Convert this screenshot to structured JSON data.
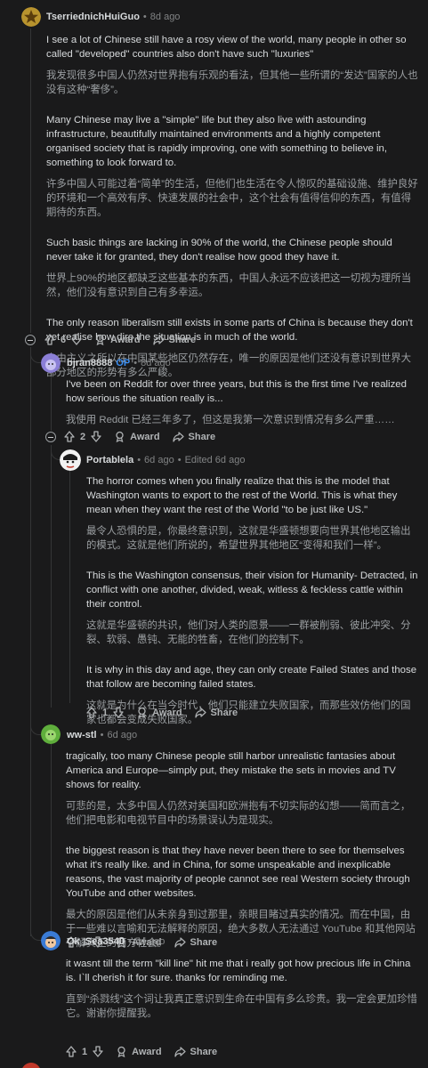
{
  "comments": [
    {
      "author": "TserriednichHuiGuo",
      "time": "8d ago",
      "paragraphs": [
        {
          "en": "I see a lot of Chinese still have a rosy view of the world, many people in other so called \"developed\" countries also don't have such \"luxuries\"",
          "zh": "我发现很多中国人仍然对世界抱有乐观的看法，但其他一些所谓的“发达”国家的人也没有这种“奢侈”。"
        },
        {
          "en": "Many Chinese may live a \"simple\" life but they also live with astounding infrastructure, beautifully maintained environments and a highly competent organised society that is rapidly improving, one with something to believe in, something to look forward to.",
          "zh": "许多中国人可能过着“简单”的生活，但他们也生活在令人惊叹的基础设施、维护良好的环境和一个高效有序、快速发展的社会中，这个社会有值得信仰的东西，有值得期待的东西。"
        },
        {
          "en": "Such basic things are lacking in 90% of the world, the Chinese people should never take it for granted, they don't realise how good they have it.",
          "zh": "世界上90%的地区都缺乏这些基本的东西，中国人永远不应该把这一切视为理所当然，他们没有意识到自己有多幸运。"
        },
        {
          "en": "The only reason liberalism still exists in some parts of China is because they don't yet realise how dire the situation is in much of the world.",
          "zh": "自由主义之所以在中国某些地区仍然存在，唯一的原因是他们还没有意识到世界大部分地区的形势有多么严峻。"
        }
      ],
      "votes": "6",
      "award": "Award",
      "share": "Share"
    },
    {
      "author": "bjran8888",
      "op": "OP",
      "time": "8d ago",
      "paragraphs": [
        {
          "en": "I've been on Reddit for over three years, but this is the first time I've realized how serious the situation really is...",
          "zh": "我使用 Reddit 已经三年多了，但这是我第一次意识到情况有多么严重……"
        }
      ],
      "votes": "2",
      "award": "Award",
      "share": "Share"
    },
    {
      "author": "Portablela",
      "time": "6d ago",
      "edited": "Edited 6d ago",
      "paragraphs": [
        {
          "en": "The horror comes when you finally realize that this is the model that Washington wants to export to the rest of the World. This is what they mean when they want the rest of the World \"to be just like US.\"",
          "zh": "最令人恐惧的是，你最终意识到，这就是华盛顿想要向世界其他地区输出的模式。这就是他们所说的，希望世界其他地区“变得和我们一样”。"
        },
        {
          "en": "This is the Washington consensus, their vision for Humanity- Detracted, in conflict with one another, divided, weak, witless & feckless cattle within their control.",
          "zh": "这就是华盛顿的共识，他们对人类的愿景——一群被削弱、彼此冲突、分裂、软弱、愚钝、无能的牲畜，在他们的控制下。"
        },
        {
          "en": "It is why in this day and age, they can only create Failed States and those that follow are becoming failed states.",
          "zh": "这就是为什么在当今时代，他们只能建立失败国家，而那些效仿他们的国家也都会变成失败国家。"
        }
      ],
      "votes": "1",
      "award": "Award",
      "share": "Share"
    },
    {
      "author": "ww-stl",
      "time": "6d ago",
      "paragraphs": [
        {
          "en": "tragically, too many Chinese people still harbor unrealistic fantasies about America and Europe—simply put, they mistake the sets in movies and TV shows for reality.",
          "zh": "可悲的是，太多中国人仍然对美国和欧洲抱有不切实际的幻想——简而言之，他们把电影和电视节目中的场景误认为是现实。"
        },
        {
          "en": "the biggest reason is that they have never been there to see for themselves what it's really like. and in China, for some unspeakable and inexplicable reasons, the vast majority of people cannot see real Western society through YouTube and other websites.",
          "zh": "最大的原因是他们从未亲身到过那里，亲眼目睹过真实的情况。而在中国，由于一些难以言喻和无法解释的原因，绝大多数人无法通过 YouTube 和其他网站了解真正的西方社会。"
        }
      ],
      "votes": "1",
      "award": "Award",
      "share": "Share"
    },
    {
      "author": "Ok_Sea3540",
      "time": "5d ago",
      "paragraphs": [
        {
          "en": "it wasnt till the term \"kill line\" hit me that i really got how precious life in China is. I`ll cherish it for sure. thanks for reminding me.",
          "zh": "直到“杀戮线”这个词让我真正意识到生命在中国有多么珍贵。我一定会更加珍惜它。谢谢你提醒我。"
        }
      ],
      "votes": "1",
      "award": "Award",
      "share": "Share"
    }
  ]
}
